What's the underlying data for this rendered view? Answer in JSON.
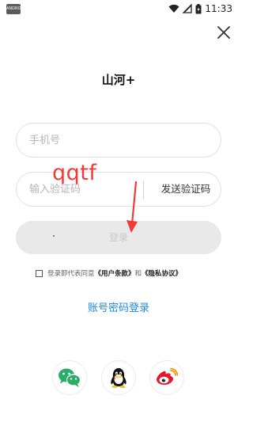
{
  "status_bar": {
    "app_badge": "ANDROID",
    "time": "11:33"
  },
  "title": "山河+",
  "phone_field": {
    "placeholder": "手机号"
  },
  "code_field": {
    "placeholder": "输入验证码",
    "send_code_label": "发送验证码"
  },
  "login_button_label": "登录",
  "agreement": {
    "prefix": "登录即代表同意",
    "user_terms": "《用户条款》",
    "and": "和",
    "privacy_policy": "《隐私协议》"
  },
  "account_password_login": "账号密码登录",
  "annotation": {
    "text": "qqtf",
    "color": "#ef3b3b"
  },
  "colors": {
    "link_blue": "#1e88e5",
    "button_disabled": "#e9e9e9",
    "wechat": "#2aae67",
    "weibo": "#e6162d"
  },
  "social_icons": [
    "wechat-icon",
    "qq-icon",
    "weibo-icon"
  ]
}
